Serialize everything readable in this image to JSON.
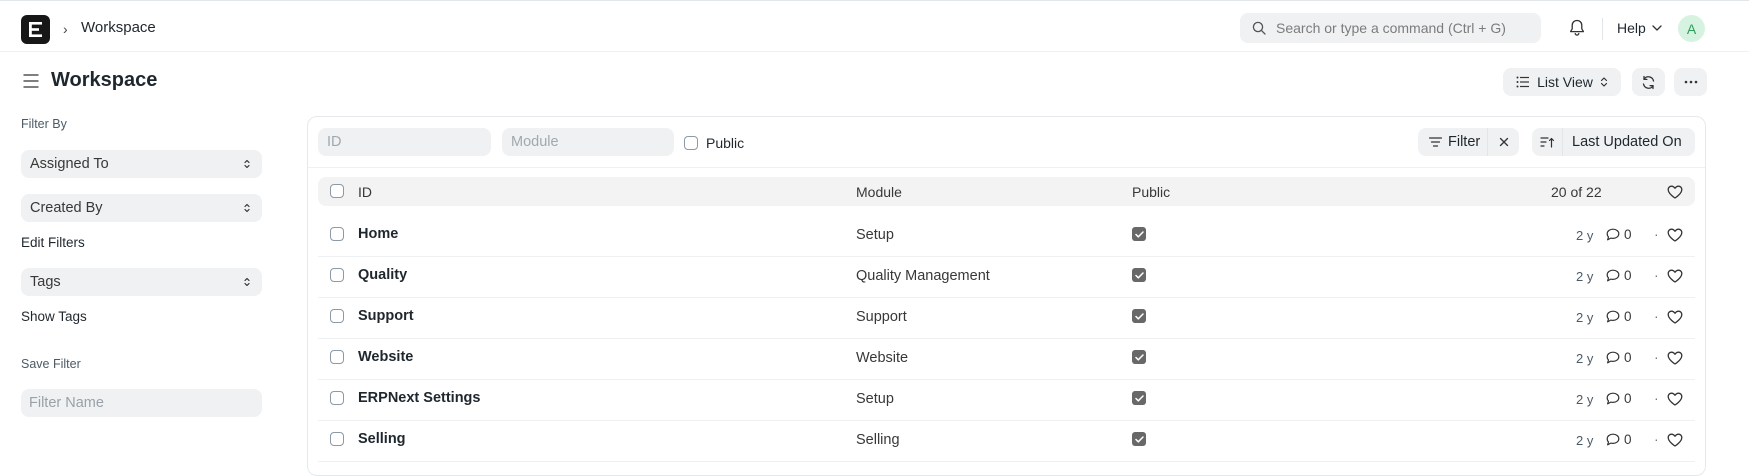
{
  "navbar": {
    "breadcrumb_sep": "›",
    "breadcrumb": "Workspace",
    "search_placeholder": "Search or type a command (Ctrl + G)",
    "help_label": "Help",
    "avatar_initial": "A"
  },
  "page": {
    "title": "Workspace",
    "list_view_label": "List View"
  },
  "sidebar": {
    "filter_by_label": "Filter By",
    "assigned_to": "Assigned To",
    "created_by": "Created By",
    "edit_filters": "Edit Filters",
    "tags": "Tags",
    "show_tags": "Show Tags",
    "save_filter_label": "Save Filter",
    "filter_name_placeholder": "Filter Name"
  },
  "filters": {
    "id_placeholder": "ID",
    "module_placeholder": "Module",
    "public_label": "Public",
    "filter_label": "Filter",
    "sort_label": "Last Updated On"
  },
  "table": {
    "columns": {
      "id": "ID",
      "module": "Module",
      "public": "Public"
    },
    "count": "20 of 22",
    "rows": [
      {
        "id": "Home",
        "module": "Setup",
        "public": true,
        "time": "2 y",
        "comments": "0"
      },
      {
        "id": "Quality",
        "module": "Quality Management",
        "public": true,
        "time": "2 y",
        "comments": "0"
      },
      {
        "id": "Support",
        "module": "Support",
        "public": true,
        "time": "2 y",
        "comments": "0"
      },
      {
        "id": "Website",
        "module": "Website",
        "public": true,
        "time": "2 y",
        "comments": "0"
      },
      {
        "id": "ERPNext Settings",
        "module": "Setup",
        "public": true,
        "time": "2 y",
        "comments": "0"
      },
      {
        "id": "Selling",
        "module": "Selling",
        "public": true,
        "time": "2 y",
        "comments": "0"
      }
    ]
  },
  "colors": {
    "accent_avatar_bg": "#d6f3e1",
    "accent_avatar_fg": "#2f9d58",
    "logo_bg": "#171717"
  }
}
